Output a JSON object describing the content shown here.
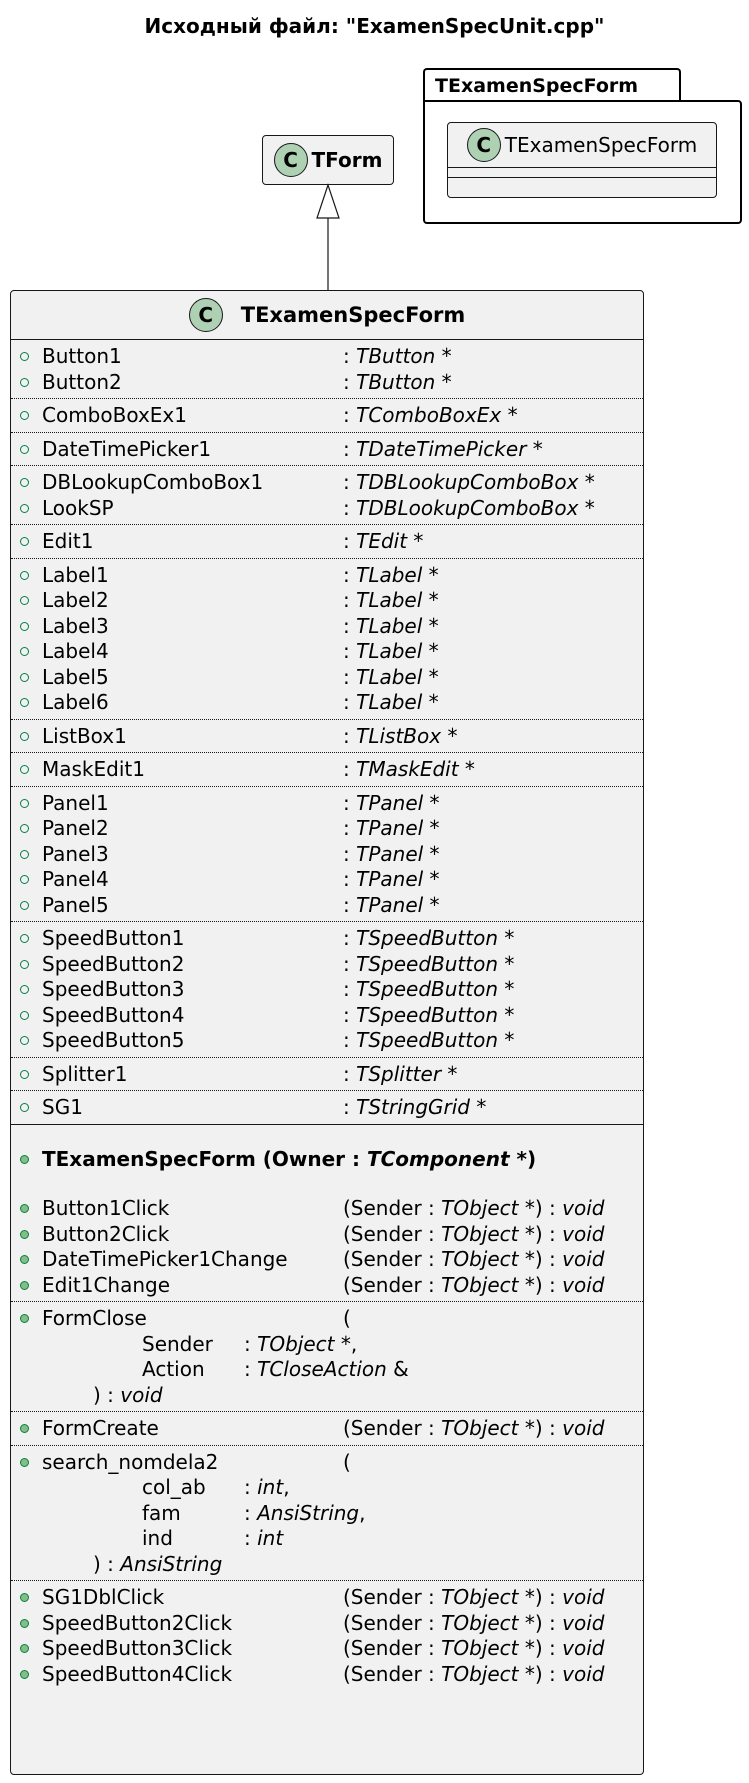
{
  "title": "Исходный файл: \"ExamenSpecUnit.cpp\"",
  "package": {
    "name": "TExamenSpecForm",
    "class_name": "TExamenSpecForm",
    "stereo_letter": "C"
  },
  "parent_class": {
    "name": "TForm",
    "stereo_letter": "C"
  },
  "main_class": {
    "name": "TExamenSpecForm",
    "stereo_letter": "C",
    "field_groups": [
      [
        {
          "name": "Button1",
          "type": "TButton *"
        },
        {
          "name": "Button2",
          "type": "TButton *"
        }
      ],
      [
        {
          "name": "ComboBoxEx1",
          "type": "TComboBoxEx *"
        }
      ],
      [
        {
          "name": "DateTimePicker1",
          "type": "TDateTimePicker *"
        }
      ],
      [
        {
          "name": "DBLookupComboBox1",
          "type": "TDBLookupComboBox *"
        },
        {
          "name": "LookSP",
          "type": "TDBLookupComboBox *"
        }
      ],
      [
        {
          "name": "Edit1",
          "type": "TEdit *"
        }
      ],
      [
        {
          "name": "Label1",
          "type": "TLabel *"
        },
        {
          "name": "Label2",
          "type": "TLabel *"
        },
        {
          "name": "Label3",
          "type": "TLabel *"
        },
        {
          "name": "Label4",
          "type": "TLabel *"
        },
        {
          "name": "Label5",
          "type": "TLabel *"
        },
        {
          "name": "Label6",
          "type": "TLabel *"
        }
      ],
      [
        {
          "name": "ListBox1",
          "type": "TListBox *"
        }
      ],
      [
        {
          "name": "MaskEdit1",
          "type": "TMaskEdit *"
        }
      ],
      [
        {
          "name": "Panel1",
          "type": "TPanel *"
        },
        {
          "name": "Panel2",
          "type": "TPanel *"
        },
        {
          "name": "Panel3",
          "type": "TPanel *"
        },
        {
          "name": "Panel4",
          "type": "TPanel *"
        },
        {
          "name": "Panel5",
          "type": "TPanel *"
        }
      ],
      [
        {
          "name": "SpeedButton1",
          "type": "TSpeedButton *"
        },
        {
          "name": "SpeedButton2",
          "type": "TSpeedButton *"
        },
        {
          "name": "SpeedButton3",
          "type": "TSpeedButton *"
        },
        {
          "name": "SpeedButton4",
          "type": "TSpeedButton *"
        },
        {
          "name": "SpeedButton5",
          "type": "TSpeedButton *"
        }
      ],
      [
        {
          "name": "Splitter1",
          "type": "TSplitter *"
        }
      ],
      [
        {
          "name": "SG1",
          "type": "TStringGrid *"
        }
      ]
    ],
    "constructor": {
      "name": "TExamenSpecForm (Owner",
      "param_sep": ":",
      "param_type": "TComponent",
      "tail": "*)"
    },
    "method_groups": [
      [
        {
          "name": "Button1Click",
          "sig": "(Sender  : ",
          "ptype": "TObject",
          "tail": " *) : ",
          "ret": "void"
        },
        {
          "name": "Button2Click",
          "sig": "(Sender  : ",
          "ptype": "TObject",
          "tail": " *) : ",
          "ret": "void"
        },
        {
          "name": "DateTimePicker1Change",
          "sig": "(Sender  : ",
          "ptype": "TObject",
          "tail": " *) : ",
          "ret": "void"
        },
        {
          "name": "Edit1Change",
          "sig": "(Sender  : ",
          "ptype": "TObject",
          "tail": " *) : ",
          "ret": "void"
        }
      ],
      [
        {
          "name": "FormClose",
          "sig": "(",
          "multiline": true,
          "params": [
            {
              "pname": "Sender",
              "ptype": "TObject",
              "ptail": " *,"
            },
            {
              "pname": "Action",
              "ptype": "TCloseAction",
              "ptail": " &"
            }
          ],
          "close": ") : ",
          "ret": "void"
        }
      ],
      [
        {
          "name": "FormCreate",
          "sig": "(Sender  : ",
          "ptype": "TObject",
          "tail": " *) : ",
          "ret": "void"
        }
      ],
      [
        {
          "name": "search_nomdela2",
          "sig": "(",
          "multiline": true,
          "params": [
            {
              "pname": "col_ab",
              "ptype": "int",
              "ptail": ","
            },
            {
              "pname": "fam",
              "ptype": "AnsiString",
              "ptail": ","
            },
            {
              "pname": "ind",
              "ptype": "int",
              "ptail": ""
            }
          ],
          "close": ") : ",
          "ret": "AnsiString"
        }
      ],
      [
        {
          "name": "SG1DblClick",
          "sig": "(Sender  : ",
          "ptype": "TObject",
          "tail": " *) : ",
          "ret": "void"
        },
        {
          "name": "SpeedButton2Click",
          "sig": "(Sender  : ",
          "ptype": "TObject",
          "tail": " *) : ",
          "ret": "void"
        },
        {
          "name": "SpeedButton3Click",
          "sig": "(Sender  : ",
          "ptype": "TObject",
          "tail": " *) : ",
          "ret": "void"
        },
        {
          "name": "SpeedButton4Click",
          "sig": "(Sender  : ",
          "ptype": "TObject",
          "tail": " *) : ",
          "ret": "void"
        }
      ]
    ]
  }
}
